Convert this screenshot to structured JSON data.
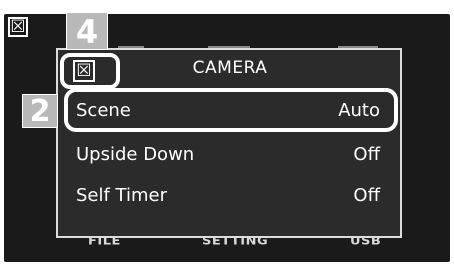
{
  "screen": {
    "corner_close_glyph": "☒",
    "bottom_tabs": [
      "FILE",
      "SETTING",
      "USB"
    ]
  },
  "callouts": {
    "first": "4",
    "second": "2"
  },
  "dialog": {
    "close_glyph": "☒",
    "title": "CAMERA",
    "items": [
      {
        "label": "Scene",
        "value": "Auto"
      },
      {
        "label": "Upside Down",
        "value": "Off"
      },
      {
        "label": "Self Timer",
        "value": "Off"
      }
    ]
  },
  "colors": {
    "screen_bg": "#1a1a1a",
    "dialog_bg": "#2b2b2b",
    "callout_bg": "#b9b9b9",
    "highlight": "#ffffff"
  }
}
